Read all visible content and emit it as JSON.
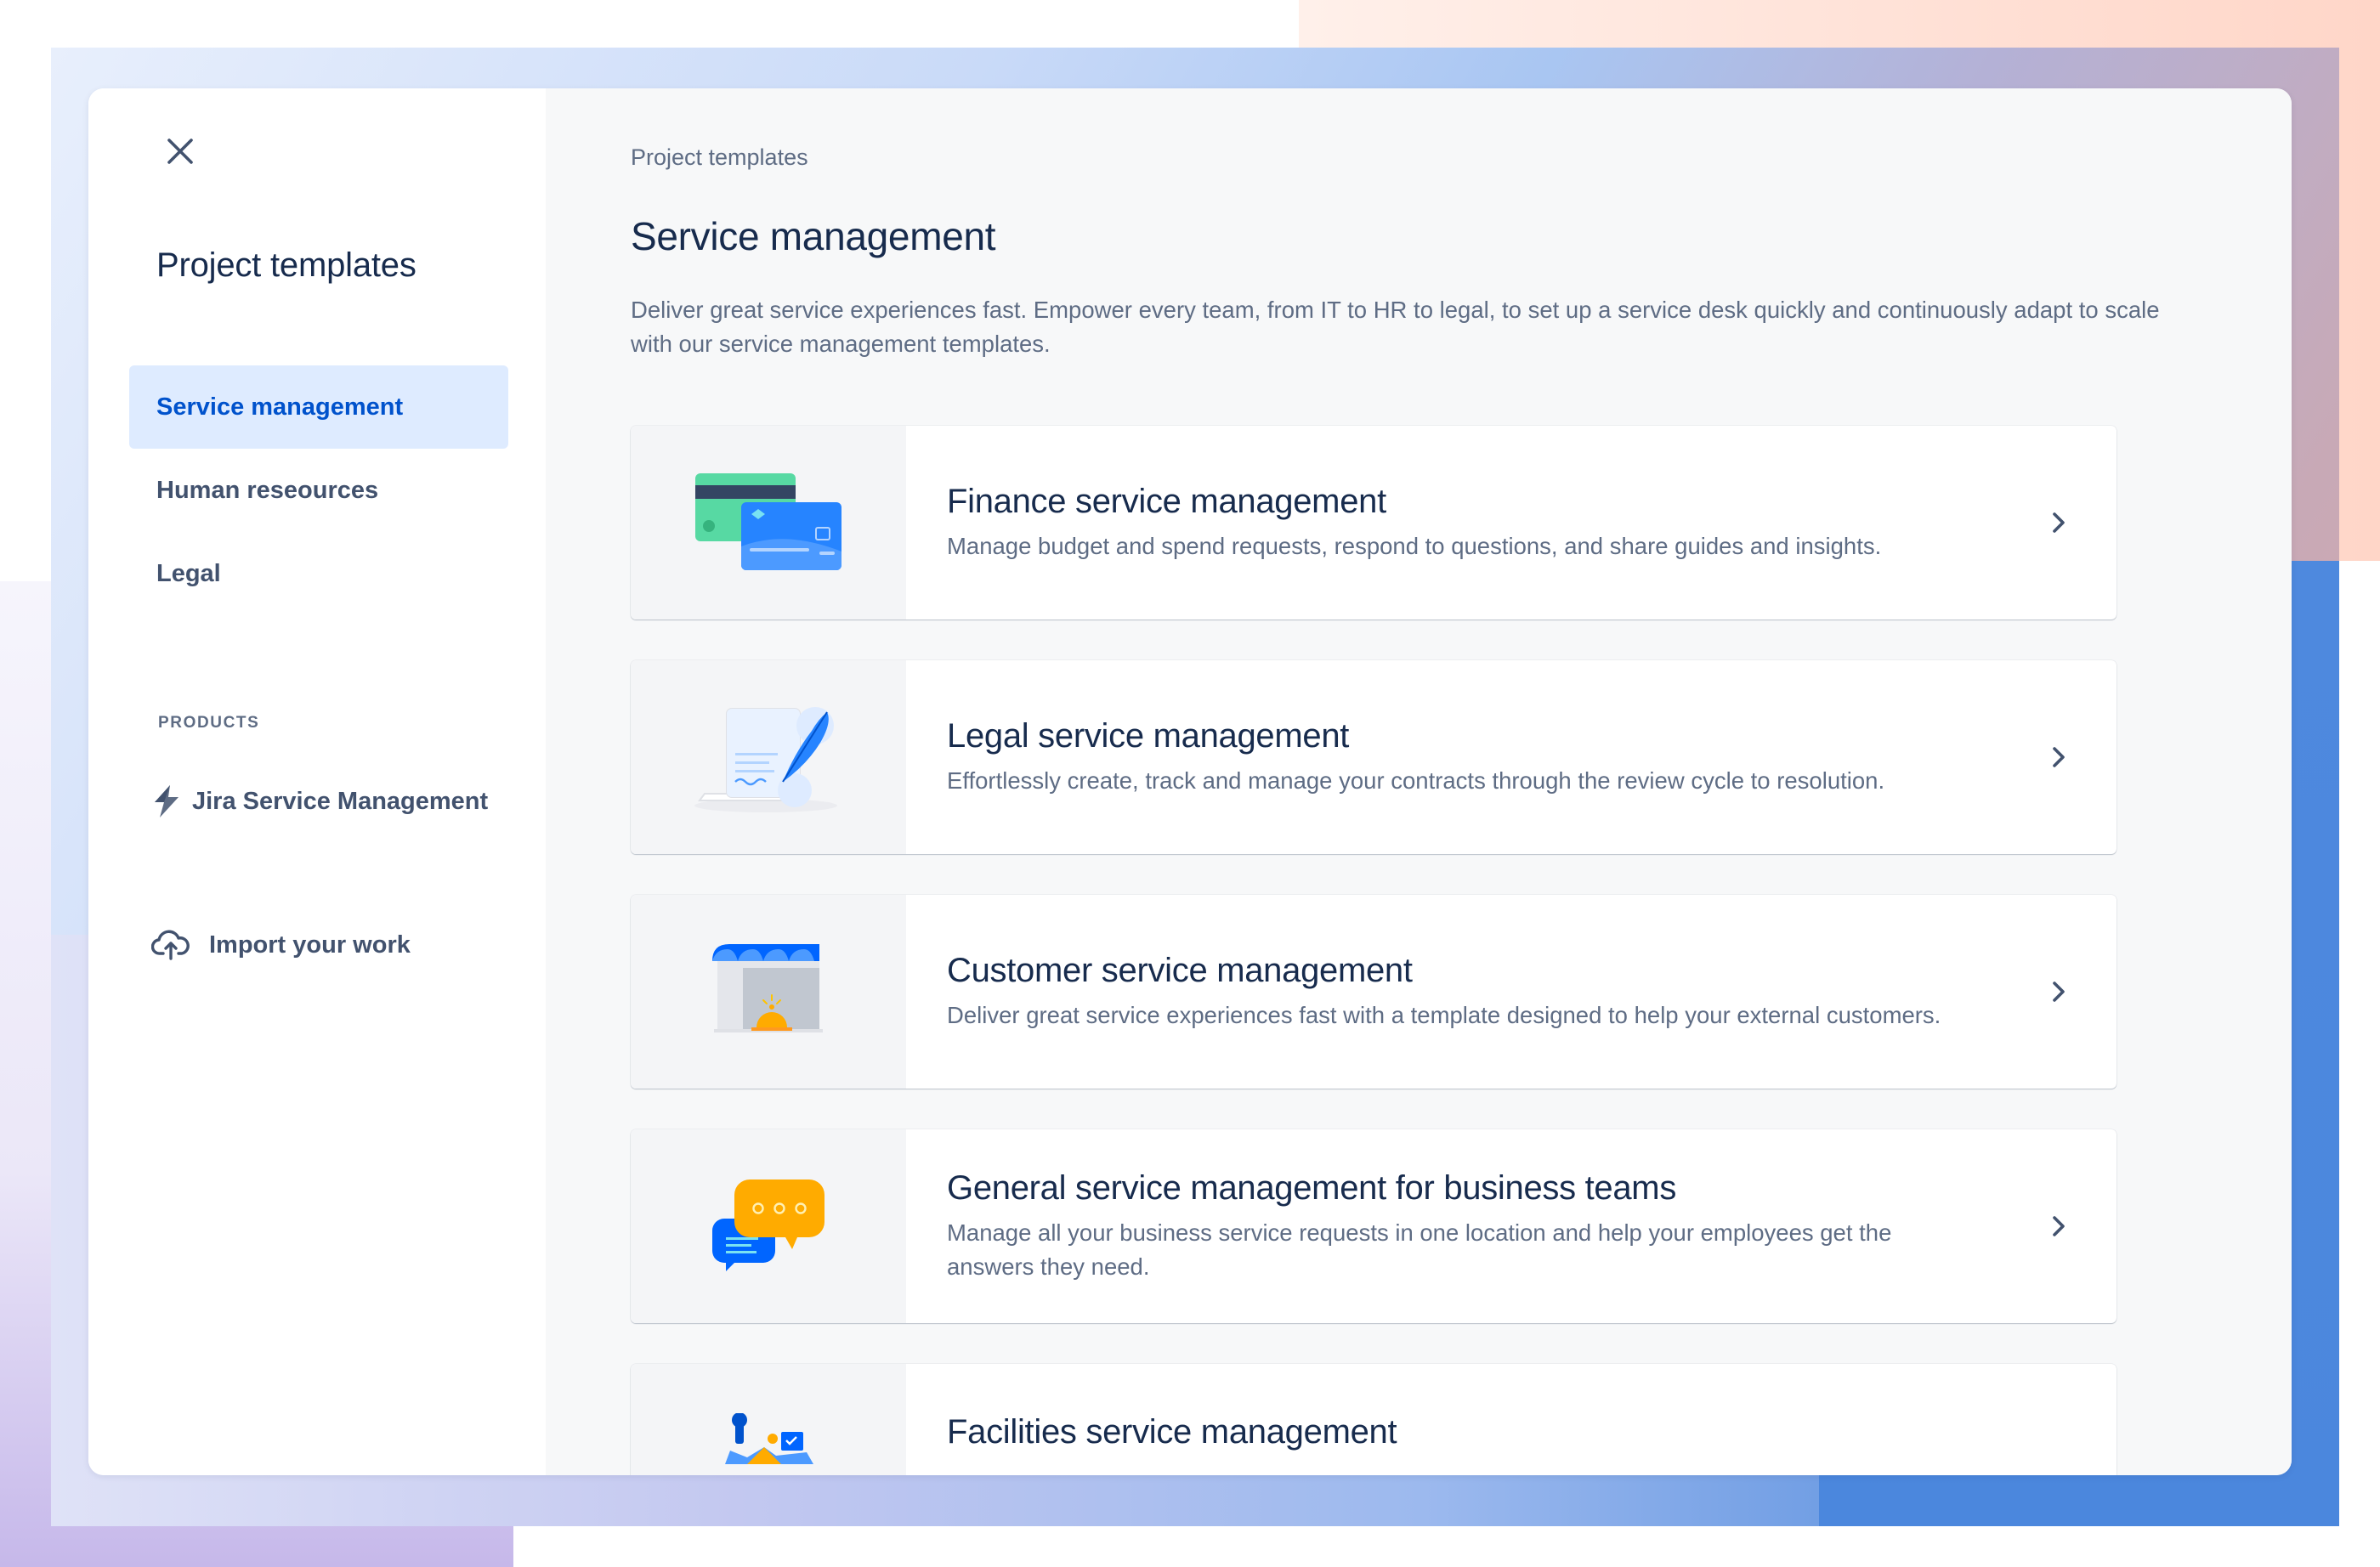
{
  "sidebar": {
    "title": "Project templates",
    "items": [
      {
        "label": "Service management",
        "active": true
      },
      {
        "label": "Human reseources",
        "active": false
      },
      {
        "label": "Legal",
        "active": false
      }
    ],
    "products_label": "PRODUCTS",
    "product": {
      "label": "Jira Service Management",
      "icon": "jira-service-management-icon"
    },
    "import": {
      "label": "Import your work",
      "icon": "cloud-upload-icon"
    }
  },
  "main": {
    "breadcrumb": "Project templates",
    "title": "Service management",
    "description": "Deliver great service experiences fast. Empower every team, from IT to HR to legal, to set up a service desk quickly and continuously adapt to scale with our service management templates.",
    "cards": [
      {
        "title": "Finance service management",
        "description": "Manage budget and spend requests, respond to questions, and share guides and insights.",
        "icon": "credit-card-icon"
      },
      {
        "title": "Legal service management",
        "description": "Effortlessly create, track and manage your contracts through the review cycle to resolution.",
        "icon": "legal-document-icon"
      },
      {
        "title": "Customer service management",
        "description": "Deliver great service experiences fast with a template designed to help your external customers.",
        "icon": "storefront-icon"
      },
      {
        "title": "General service management for business teams",
        "description": "Manage all your business service requests in one location and help your employees get the answers they need.",
        "icon": "chat-bubbles-icon"
      },
      {
        "title": "Facilities service management",
        "description": "",
        "icon": "facilities-tools-icon"
      }
    ]
  },
  "colors": {
    "accent": "#0052CC",
    "active_bg": "#DEEBFF",
    "heading": "#172B4D",
    "body_text": "#5E6C84"
  }
}
